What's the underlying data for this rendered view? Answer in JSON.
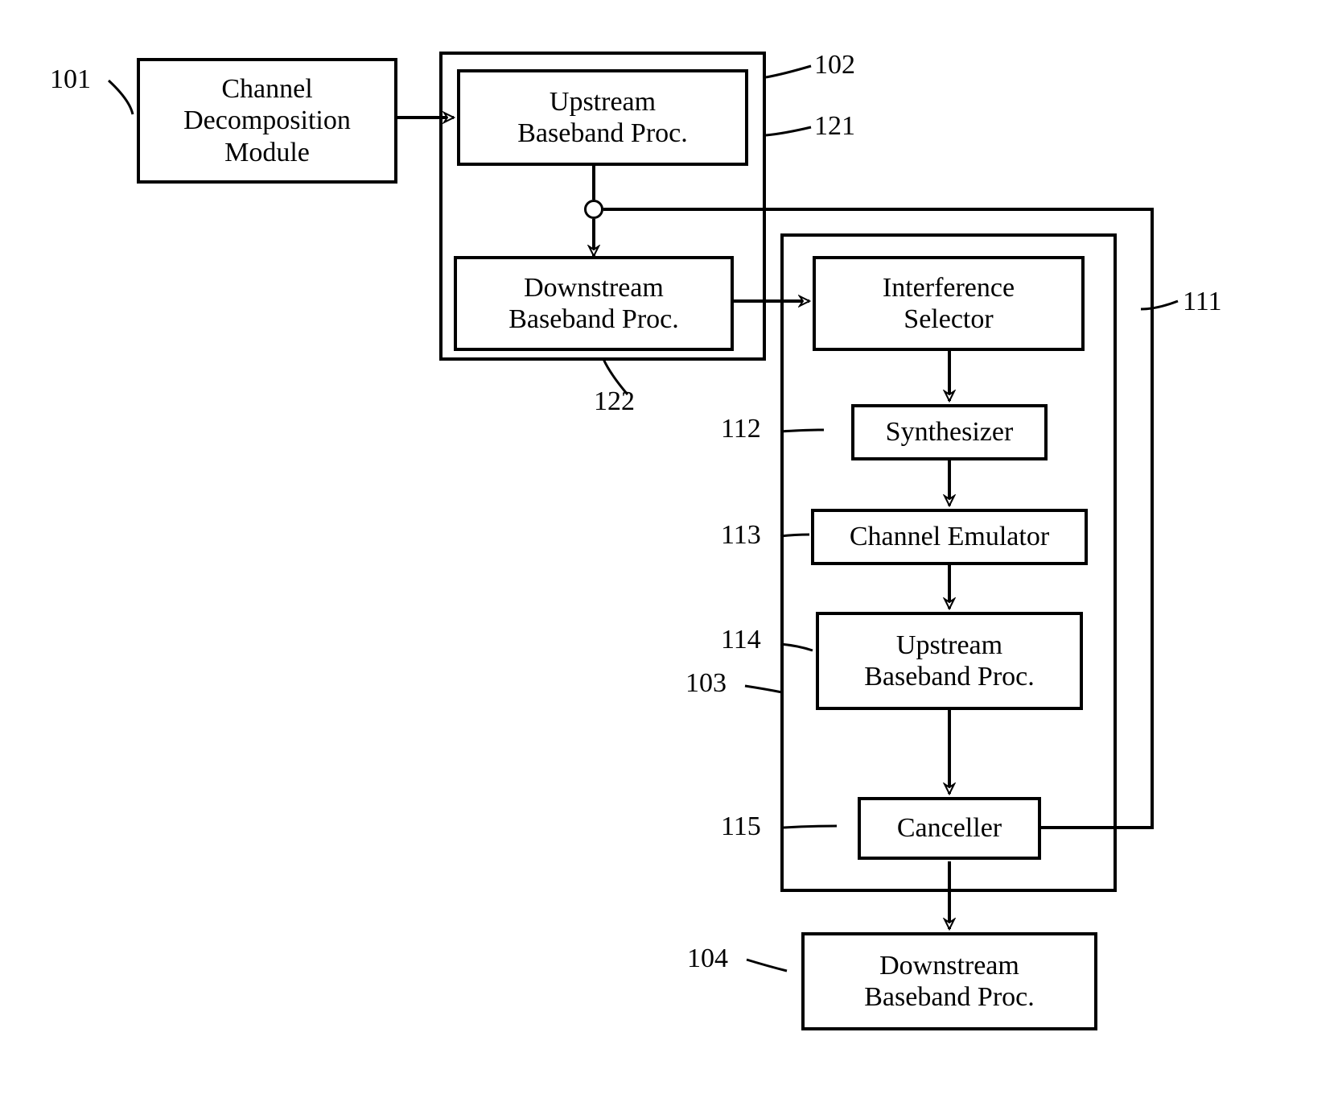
{
  "blocks": {
    "channel_decomposition": "Channel\nDecomposition\nModule",
    "upstream_bb_1": "Upstream\nBaseband Proc.",
    "downstream_bb_1": "Downstream\nBaseband Proc.",
    "interference_selector": "Interference\nSelector",
    "synthesizer": "Synthesizer",
    "channel_emulator": "Channel Emulator",
    "upstream_bb_2": "Upstream\nBaseband Proc.",
    "canceller": "Canceller",
    "downstream_bb_2": "Downstream\nBaseband Proc."
  },
  "labels": {
    "101": "101",
    "102": "102",
    "121": "121",
    "122": "122",
    "111": "111",
    "112": "112",
    "113": "113",
    "114": "114",
    "103": "103",
    "115": "115",
    "104": "104"
  }
}
